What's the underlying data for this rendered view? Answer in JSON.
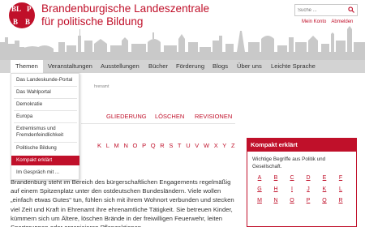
{
  "header": {
    "logo_letters": [
      "BL",
      "P",
      "B",
      "B"
    ],
    "title_line1": "Brandenburgische Landeszentrale",
    "title_line2": "für politische Bildung",
    "search_placeholder": "Suche ...",
    "links": [
      "Mein Konto",
      "Abmelden"
    ]
  },
  "nav": {
    "items": [
      "Themen",
      "Veranstaltungen",
      "Ausstellungen",
      "Bücher",
      "Förderung",
      "Blogs",
      "Über uns",
      "Leichte Sprache"
    ],
    "active": "Themen"
  },
  "dropdown": {
    "items": [
      "Das Landeskunde-Portal",
      "Das Wahlportal",
      "Demokratie",
      "Europa",
      "Extremismus und Fremdenfeindlichkeit",
      "Politische Bildung",
      "Kompakt erklärt",
      "Im Gespräch mit ..."
    ],
    "selected": "Kompakt erklärt"
  },
  "breadcrumb": "hrenamt",
  "tabs": [
    "GLIEDERUNG",
    "LÖSCHEN",
    "REVISIONEN"
  ],
  "alphabet_partial": [
    "K",
    "L",
    "M",
    "N",
    "O",
    "P",
    "Q",
    "R",
    "S",
    "T",
    "U",
    "V",
    "W",
    "X",
    "Y",
    "Z"
  ],
  "article": {
    "text": "Brandenburg steht im Bereich des bürgerschaftlichen Engagements regelmäßig auf einem Spitzenplatz unter den ostdeutschen Bundesländern. Viele wollen „einfach etwas Gutes\" tun, fühlen sich mit ihrem Wohnort verbunden und stecken viel Zeit und Kraft in Ehrenamt ihre ehrenamtliche Tätigkeit. Sie betreuen Kinder, kümmern sich um Ältere, löschen Brände in der freiwilligen Feuerwehr, leiten Sportgruppen oder organisieren Pflanzaktionen."
  },
  "sidebar": {
    "heading": "Kompakt erklärt",
    "text": "Wichtige Begriffe aus Politik und Gesellschaft.",
    "letters": [
      "A",
      "B",
      "C",
      "D",
      "E",
      "F",
      "G",
      "H",
      "I",
      "J",
      "K",
      "L",
      "M",
      "N",
      "O",
      "P",
      "Q",
      "R"
    ]
  },
  "colors": {
    "brand": "#c0102a",
    "nav_bg": "#d3d3d3",
    "skyline": "#c9c9c9"
  }
}
